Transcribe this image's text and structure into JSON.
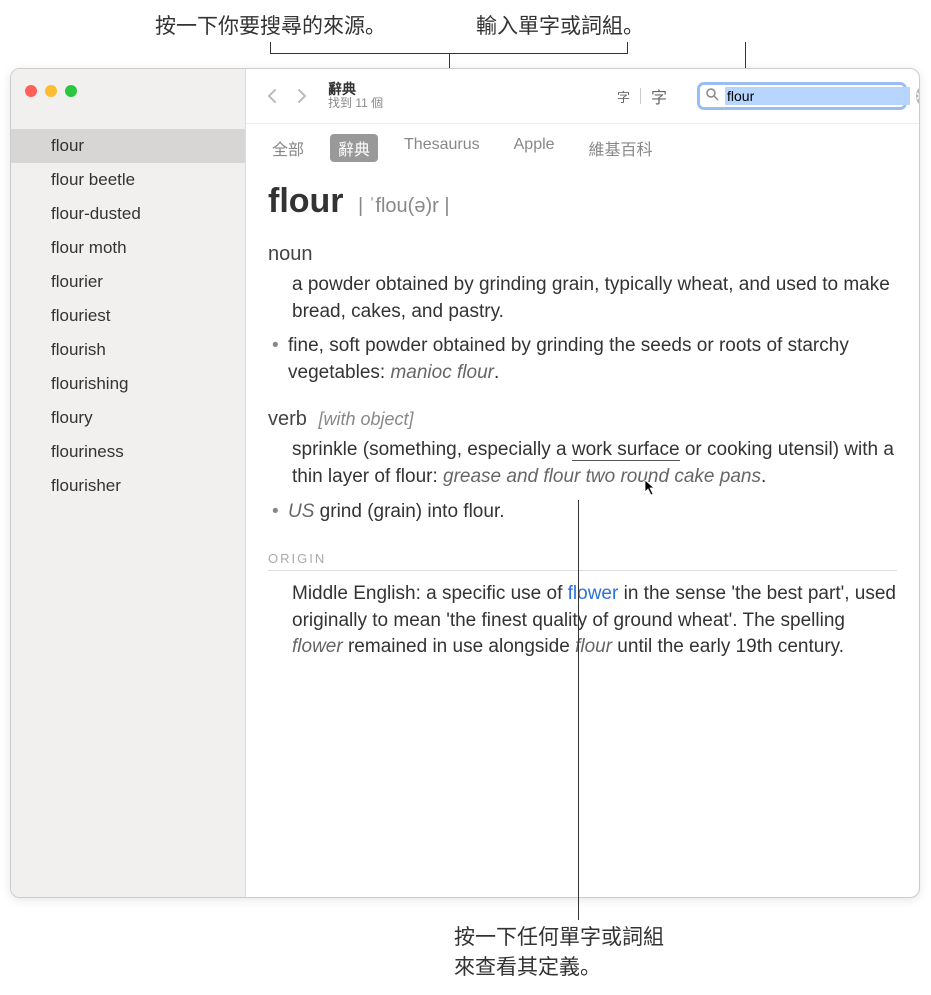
{
  "callouts": {
    "top_left": "按一下你要搜尋的來源。",
    "top_right": "輸入單字或詞組。",
    "bottom_1": "按一下任何單字或詞組",
    "bottom_2": "來查看其定義。"
  },
  "window": {
    "title": "辭典",
    "subtitle": "找到 11 個"
  },
  "search": {
    "value": "flour"
  },
  "font_buttons": {
    "small": "字",
    "large": "字"
  },
  "source_tabs": [
    {
      "label": "全部",
      "active": false
    },
    {
      "label": "辭典",
      "active": true
    },
    {
      "label": "Thesaurus",
      "active": false
    },
    {
      "label": "Apple",
      "active": false
    },
    {
      "label": "維基百科",
      "active": false
    }
  ],
  "sidebar": [
    "flour",
    "flour beetle",
    "flour-dusted",
    "flour moth",
    "flourier",
    "flouriest",
    "flourish",
    "flourishing",
    "floury",
    "flouriness",
    "flourisher"
  ],
  "entry": {
    "headword": "flour",
    "pronunciation": "| ˈflou(ə)r |",
    "noun": {
      "label": "noun",
      "def": "a powder obtained by grinding grain, typically wheat, and used to make bread, cakes, and pastry.",
      "sub": "fine, soft powder obtained by grinding the seeds or roots of starchy vegetables: ",
      "sub_example": "manioc flour",
      "sub_period": "."
    },
    "verb": {
      "label": "verb",
      "note": "[with object]",
      "def_pre": "sprinkle (something, especially a ",
      "def_link": "work surface",
      "def_post": " or cooking utensil) with a thin layer of flour: ",
      "def_example": "grease and flour two round cake pans",
      "def_period": ".",
      "sub_region": "US",
      "sub": " grind (grain) into flour."
    },
    "origin": {
      "label": "ORIGIN",
      "t1": "Middle English: a specific use of ",
      "link": "flower",
      "t2": " in the sense 'the best part', used originally to mean 'the finest quality of ground wheat'. The spelling ",
      "i1": "flower",
      "t3": " remained in use alongside ",
      "i2": "flour",
      "t4": " until the early 19th century."
    }
  }
}
